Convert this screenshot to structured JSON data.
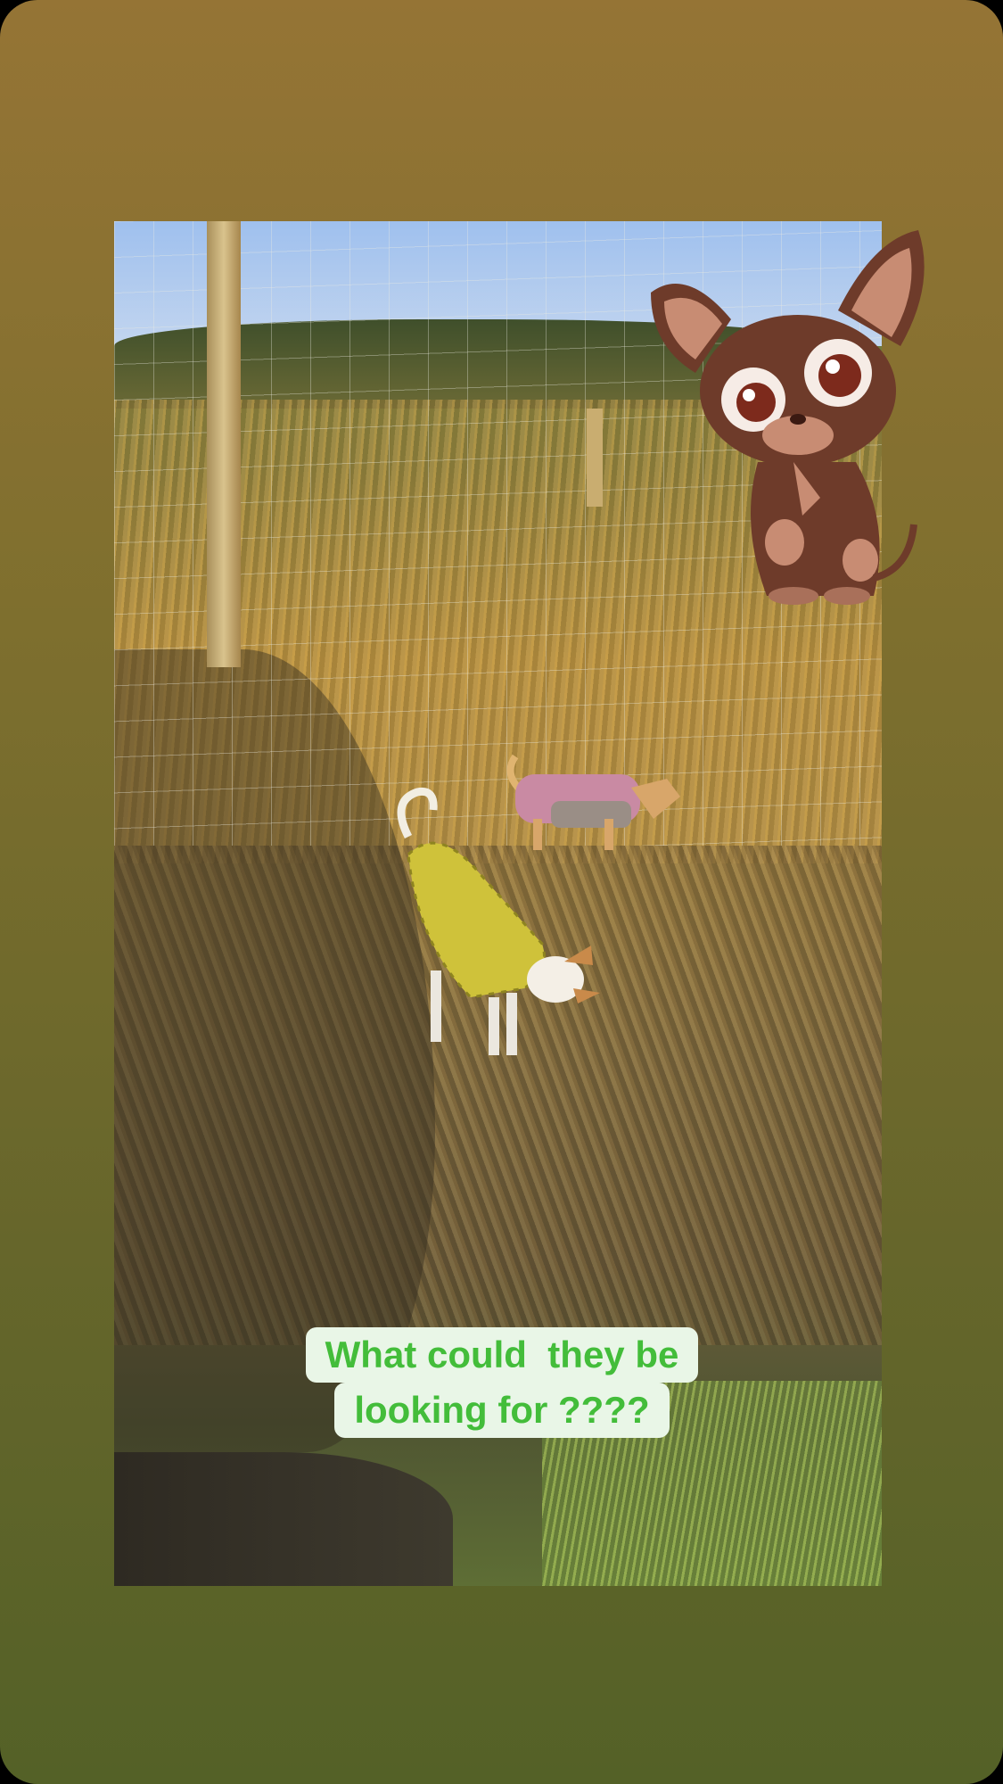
{
  "story": {
    "caption_lines": [
      "What could  they be",
      "looking for ????"
    ],
    "colors": {
      "background_top": "#957435",
      "background_bottom": "#546127",
      "caption_text": "#43bd3a",
      "caption_background": "#e9f6e7"
    },
    "sticker": "cartoon-chihuahua-sticker",
    "photo": "two-dogs-in-tall-grass-photo"
  }
}
